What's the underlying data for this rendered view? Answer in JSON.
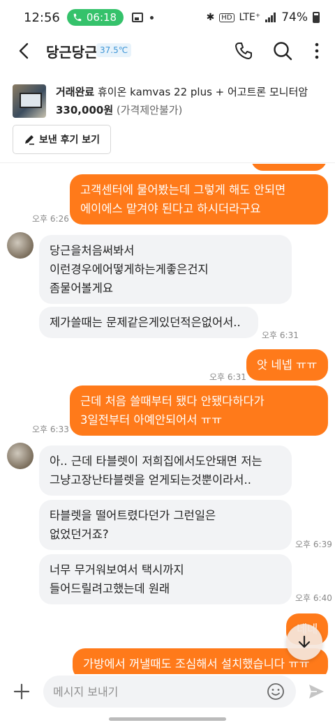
{
  "status_bar": {
    "time": "12:56",
    "call_time": "06:18",
    "network": "LTE⁺",
    "battery": "74%"
  },
  "header": {
    "title": "당근당근",
    "manner_temp": "37.5℃"
  },
  "product": {
    "status": "거래완료",
    "name": "휴이온 kamvas 22 plus + 어고트론 모니터암",
    "price": "330,000원",
    "price_note": "(가격제안불가)",
    "review_button": "보낸 후기 보기"
  },
  "messages": [
    {
      "from": "me",
      "lines": [
        "고객센터에 물어봤는데 그렇게 해도 안되면",
        "에이에스 맡겨야 된다고 하시더라구요"
      ],
      "time": "오후 6:26"
    },
    {
      "from": "other",
      "lines": [
        "당근을처음써봐서",
        "이런경우에어떻게하는게좋은건지",
        "좀물어볼게요"
      ],
      "time": ""
    },
    {
      "from": "other",
      "lines": [
        "제가쓸때는 문제같은게있던적은없어서.."
      ],
      "time": "오후 6:31"
    },
    {
      "from": "me",
      "lines": [
        "앗 네넵 ㅠㅠ"
      ],
      "time": "오후 6:31"
    },
    {
      "from": "me",
      "lines": [
        "근데 처음 쓸때부터 됐다 안됐다하다가",
        "3일전부터 아예안되어서 ㅠㅠ"
      ],
      "time": "오후 6:33"
    },
    {
      "from": "other",
      "lines": [
        "아.. 근데 타블렛이 저희집에서도안돼면 저는",
        "그냥고장난타블렛을 얻게되는것뿐이라서.."
      ],
      "time": ""
    },
    {
      "from": "other",
      "lines": [
        "타블렛을 떨어트렸다던가 그런일은",
        "없었던거죠?"
      ],
      "time": "오후 6:39"
    },
    {
      "from": "other",
      "lines": [
        "너무 무거워보여서 택시까지",
        "들어드릴려고했는데 원래"
      ],
      "time": "오후 6:40"
    },
    {
      "from": "me",
      "lines": [
        "네네"
      ],
      "time": ""
    },
    {
      "from": "me",
      "lines": [
        "가방에서 꺼낼때도 조심해서 설치했습니다 ㅠㅠ"
      ],
      "time": ""
    }
  ],
  "input": {
    "placeholder": "메시지 보내기"
  },
  "colors": {
    "accent": "#ff7a1a",
    "bubble_other": "#f2f3f5",
    "call_green": "#35c26b",
    "temp_blue": "#3d95d6"
  },
  "icons": [
    "back-arrow-icon",
    "phone-icon",
    "search-icon",
    "more-vert-icon",
    "pencil-icon",
    "plus-icon",
    "emoji-icon",
    "send-icon",
    "arrow-down-icon"
  ]
}
